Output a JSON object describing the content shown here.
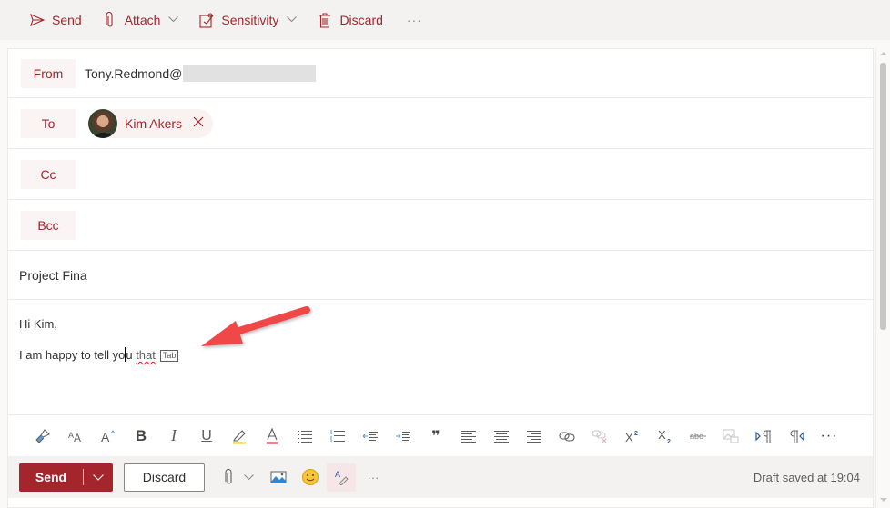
{
  "commandbar": {
    "send_label": "Send",
    "attach_label": "Attach",
    "sensitivity_label": "Sensitivity",
    "discard_label": "Discard",
    "more_label": "···"
  },
  "header": {
    "from_label": "From",
    "from_value": "Tony.Redmond@",
    "to_label": "To",
    "to_recipients": [
      {
        "name": "Kim Akers",
        "remove_icon": "×"
      }
    ],
    "cc_label": "Cc",
    "bcc_label": "Bcc",
    "subject": "Project Fina"
  },
  "body": {
    "greeting": "Hi Kim,",
    "line_before_caret": "I am happy to tell yo",
    "line_after_caret": "u ",
    "suggestion_word": "that",
    "tab_hint": "Tab"
  },
  "format_toolbar": {
    "items": [
      "format-painter",
      "font-size",
      "grow-font",
      "bold",
      "italic",
      "underline",
      "highlight",
      "font-color",
      "bullets",
      "numbering",
      "decrease-indent",
      "increase-indent",
      "quote",
      "align-left",
      "align-center",
      "align-right",
      "insert-link",
      "remove-link",
      "superscript",
      "subscript",
      "strikethrough",
      "insert-picture-inline",
      "ltr",
      "rtl",
      "more"
    ],
    "bold_glyph": "B",
    "italic_glyph": "I",
    "underline_glyph": "U",
    "quote_glyph": "❞",
    "superscript_glyph": "X",
    "subscript_glyph": "X",
    "strike_glyph": "abc",
    "more_glyph": "···"
  },
  "actionbar": {
    "send_label": "Send",
    "discard_label": "Discard",
    "more_label": "···",
    "draft_status": "Draft saved at 19:04"
  },
  "colors": {
    "accent": "#a4262c",
    "label_bg": "#faf4f4",
    "toolbar_bg": "#f3f2f1",
    "annotation_arrow": "#f0474a"
  }
}
